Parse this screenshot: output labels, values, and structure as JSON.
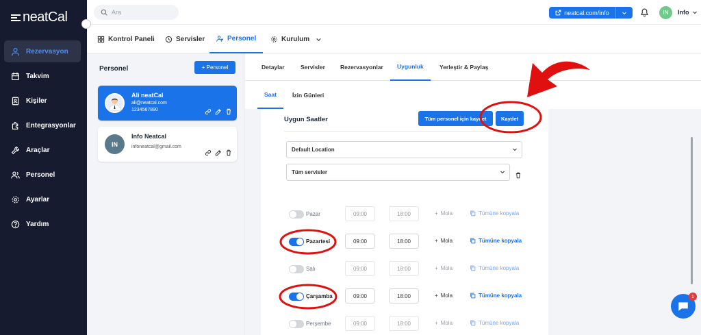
{
  "brand": {
    "logo_text": "neatCal"
  },
  "sidebar": {
    "items": [
      {
        "label": "Rezervasyon",
        "icon": "user-icon",
        "active": true
      },
      {
        "label": "Takvim",
        "icon": "calendar-icon"
      },
      {
        "label": "Kişiler",
        "icon": "contacts-icon"
      },
      {
        "label": "Entegrasyonlar",
        "icon": "puzzle-icon"
      },
      {
        "label": "Araçlar",
        "icon": "wrench-icon"
      },
      {
        "label": "Personel",
        "icon": "users-icon"
      },
      {
        "label": "Ayarlar",
        "icon": "gear-icon"
      },
      {
        "label": "Yardım",
        "icon": "help-icon"
      }
    ]
  },
  "topbar": {
    "search_placeholder": "Ara",
    "url_button": "neatcal.com/info",
    "avatar_initials": "IN",
    "user_name": "Info"
  },
  "tabs": [
    {
      "label": "Kontrol Paneli",
      "icon": "dashboard-icon"
    },
    {
      "label": "Servisler",
      "icon": "clock-icon"
    },
    {
      "label": "Personel",
      "icon": "users-icon",
      "active": true
    },
    {
      "label": "Kurulum",
      "icon": "setup-icon"
    }
  ],
  "staff_panel": {
    "title": "Personel",
    "add_button": "+ Personel",
    "staff": [
      {
        "name": "Ali neatCal",
        "email": "ali@neatcal.com",
        "phone": "1234567890",
        "selected": true
      },
      {
        "name": "Info Neatcal",
        "email": "infoneatcal@gmail.com",
        "initials": "IN"
      }
    ]
  },
  "subtabs": [
    "Detaylar",
    "Servisler",
    "Rezervasyonlar",
    "Uygunluk",
    "Yerleştir & Paylaş"
  ],
  "subtabs_active": "Uygunluk",
  "subtabs2": [
    "Saat",
    "İzin Günleri"
  ],
  "availability": {
    "title": "Uygun Saatler",
    "save_all_button": "Tüm personel için kaydet",
    "save_button": "Kaydet",
    "location_select": "Default Location",
    "services_select": "Tüm servisler",
    "break_label": "Mola",
    "copy_label": "Tümüne kopyala",
    "days": [
      {
        "name": "Pazar",
        "enabled": false,
        "start": "09:00",
        "end": "18:00"
      },
      {
        "name": "Pazartesi",
        "enabled": true,
        "start": "09:00",
        "end": "18:00"
      },
      {
        "name": "Salı",
        "enabled": false,
        "start": "09:00",
        "end": "18:00"
      },
      {
        "name": "Çarşamba",
        "enabled": true,
        "start": "09:00",
        "end": "18:00"
      },
      {
        "name": "Perşembe",
        "enabled": false,
        "start": "09:00",
        "end": "18:00"
      }
    ]
  },
  "chat": {
    "badge": "1"
  },
  "colors": {
    "primary": "#1a73e8",
    "sidebar": "#171b2f",
    "annotation": "#e01010"
  }
}
